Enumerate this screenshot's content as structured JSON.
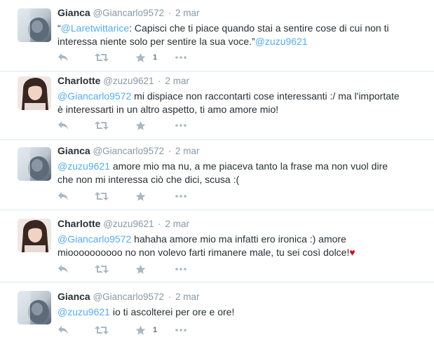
{
  "tweets": [
    {
      "fullname": "Gianca",
      "username": "@Giancarlo9572",
      "dot": "·",
      "time": "2 mar",
      "avatar": "avatar-gianca",
      "lines": [
        [
          {
            "t": "“",
            "c": "text"
          },
          {
            "t": "@Laretwittarice",
            "c": "mention"
          },
          {
            "t": ": Capisci che ti piace quando stai a sentire cose di cui non ti",
            "c": "text"
          }
        ],
        [
          {
            "t": "interessa niente solo per sentire la sua voce.”",
            "c": "text"
          },
          {
            "t": "@zuzu9621",
            "c": "mention"
          }
        ]
      ],
      "fav_count": "1"
    },
    {
      "fullname": "Charlotte",
      "username": "@zuzu9621",
      "dot": "·",
      "time": "2 mar",
      "avatar": "avatar-charlotte",
      "lines": [
        [
          {
            "t": "@Giancarlo9572",
            "c": "mention"
          },
          {
            "t": " mi dispiace non raccontarti cose interessanti :/ ma l'importate",
            "c": "text"
          }
        ],
        [
          {
            "t": "è interessarti in un altro aspetto, ti amo amore mio!",
            "c": "text"
          }
        ]
      ],
      "fav_count": ""
    },
    {
      "fullname": "Gianca",
      "username": "@Giancarlo9572",
      "dot": "·",
      "time": "2 mar",
      "avatar": "avatar-gianca",
      "lines": [
        [
          {
            "t": "@zuzu9621",
            "c": "mention"
          },
          {
            "t": " amore mio ma nu, a me piaceva tanto la frase ma non vuol dire",
            "c": "text"
          }
        ],
        [
          {
            "t": "che non mi interessa ciò che dici, scusa :(",
            "c": "text"
          }
        ]
      ],
      "fav_count": ""
    },
    {
      "fullname": "Charlotte",
      "username": "@zuzu9621",
      "dot": "·",
      "time": "2 mar",
      "avatar": "avatar-charlotte",
      "lines": [
        [
          {
            "t": "@Giancarlo9572",
            "c": "mention"
          },
          {
            "t": " hahaha amore mio ma infatti ero ironica :) amore",
            "c": "text"
          }
        ],
        [
          {
            "t": "mioooooooooo no non volevo farti rimanere male, tu sei così dolce!",
            "c": "text"
          },
          {
            "t": "♥",
            "c": "heart"
          }
        ]
      ],
      "fav_count": ""
    },
    {
      "fullname": "Gianca",
      "username": "@Giancarlo9572",
      "dot": "·",
      "time": "2 mar",
      "avatar": "avatar-gianca",
      "lines": [
        [
          {
            "t": "@zuzu9621",
            "c": "mention"
          },
          {
            "t": " io ti ascolterei per ore e ore!",
            "c": "text"
          }
        ]
      ],
      "fav_count": "1"
    }
  ],
  "icons": {
    "reply": "reply-icon",
    "retweet": "retweet-icon",
    "favorite": "star-icon",
    "more": "more-icon"
  },
  "colors": {
    "link": "#55acee",
    "meta": "#8899a6",
    "action": "#aab8c2",
    "divider": "#e1e8ed",
    "heart": "#c8102e"
  }
}
